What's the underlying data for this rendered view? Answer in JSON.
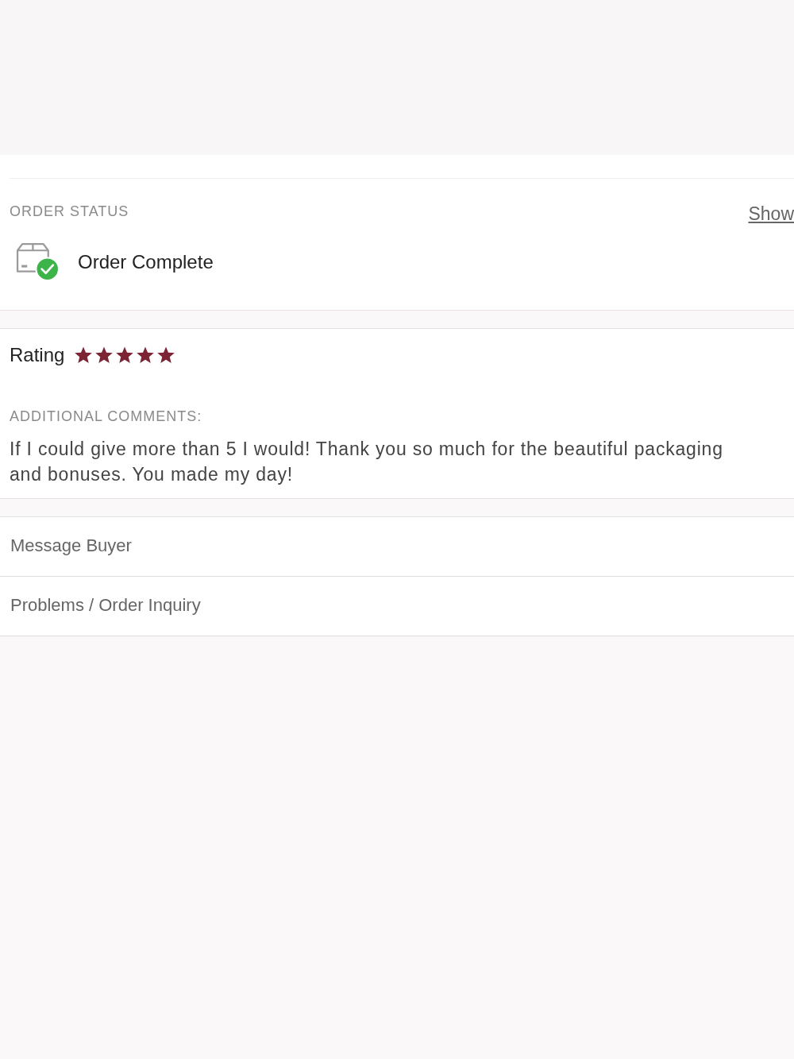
{
  "order_status": {
    "heading": "ORDER STATUS",
    "link": "Show",
    "status": "Order Complete"
  },
  "rating": {
    "label": "Rating",
    "stars": 5
  },
  "comments": {
    "heading": "ADDITIONAL COMMENTS:",
    "text": "If I could give more than 5 I would! Thank you so much for the beautiful packaging and bonuses. You made my day!"
  },
  "actions": [
    {
      "label": "Message Buyer"
    },
    {
      "label": "Problems / Order Inquiry"
    }
  ]
}
